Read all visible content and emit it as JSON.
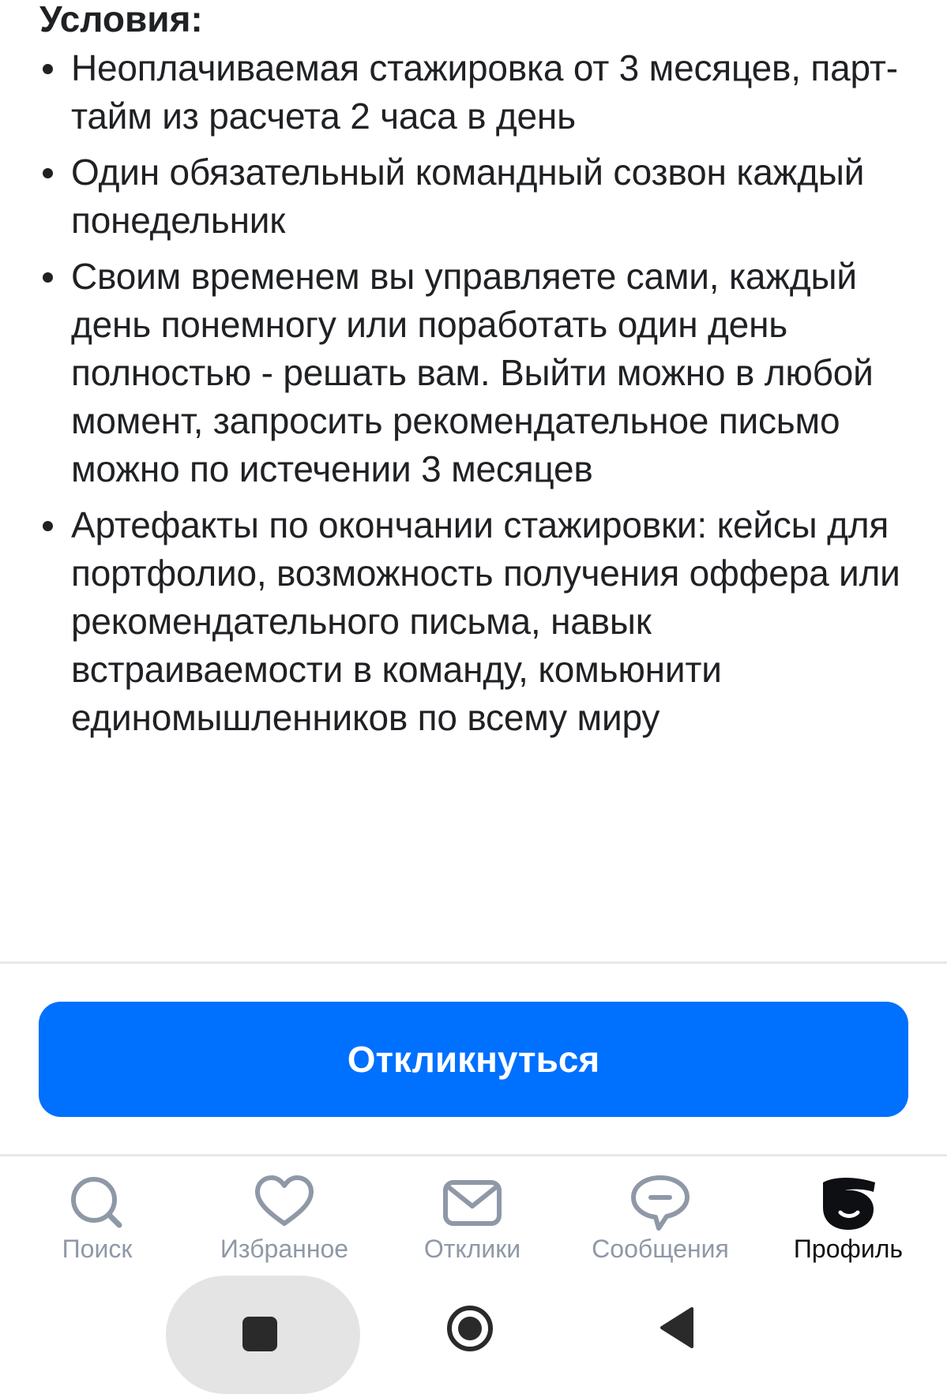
{
  "section": {
    "title": "Условия:"
  },
  "conditions": [
    {
      "text": "Неоплачиваемая стажировка от 3 месяцев, парт-тайм из расчета 2 часа в день"
    },
    {
      "text": "Один обязательный командный созвон каждый понедельник"
    },
    {
      "text": "Своим временем вы управляете сами, каждый день понемногу или поработать один день полностью - решать вам. Выйти можно в любой момент, запросить рекомендательное письмо можно по истечении 3 месяцев"
    },
    {
      "text": "Артефакты по окончании стажировки: кейсы для портфолио, возможность получения оффера или рекомендательного письма, навык встраиваемости в команду, комьюнити единомышленников по всему миру"
    }
  ],
  "apply_button": {
    "label": "Откликнуться",
    "color": "#0070ff"
  },
  "tabbar": {
    "items": [
      {
        "label": "Поиск",
        "icon": "search-icon",
        "active": false
      },
      {
        "label": "Избранное",
        "icon": "heart-icon",
        "active": false
      },
      {
        "label": "Отклики",
        "icon": "envelope-icon",
        "active": false
      },
      {
        "label": "Сообщения",
        "icon": "chat-bubble-icon",
        "active": false
      },
      {
        "label": "Профиль",
        "icon": "profile-logo-icon",
        "active": true
      }
    ],
    "inactive_color": "#8f98a6",
    "active_color": "#0d0f12"
  },
  "system_nav": {
    "icons": [
      "recent-apps-icon",
      "home-icon",
      "back-icon"
    ]
  }
}
